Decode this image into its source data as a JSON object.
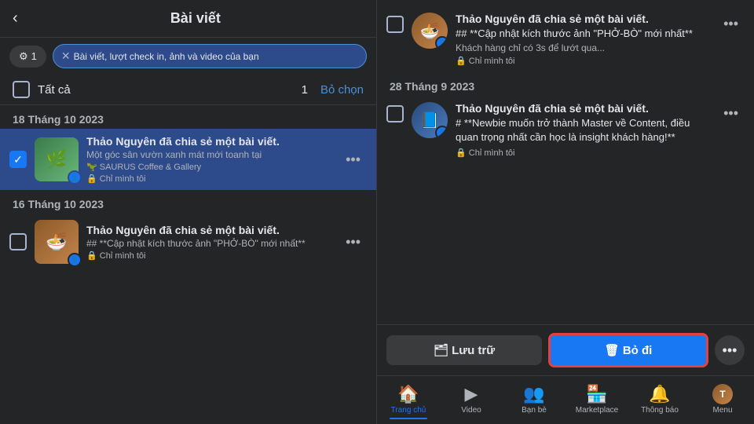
{
  "leftPanel": {
    "header": {
      "back": "‹",
      "title": "Bài viết"
    },
    "filterBtn": {
      "icon": "⚙",
      "number": "1"
    },
    "filterTag": {
      "close": "✕",
      "label": "Bài viết, lượt check in, ảnh và video của bạn"
    },
    "selectBar": {
      "label": "Tất cả",
      "count": "1",
      "deselect": "Bỏ chọn"
    },
    "dateGroups": [
      {
        "date": "18 Tháng 10 2023",
        "posts": [
          {
            "id": "post1",
            "selected": true,
            "thumbType": "garden",
            "thumbEmoji": "🌿",
            "author": "Thảo Nguyên đã chia sẻ một bài viết.",
            "preview": "Một góc sân vườn xanh mát mới toanh tại",
            "location": "🦖 SAURUS Coffee & Gallery",
            "privacy": "🔒 Chỉ mình tôi"
          }
        ]
      },
      {
        "date": "16 Tháng 10 2023",
        "posts": [
          {
            "id": "post2",
            "selected": false,
            "thumbType": "food",
            "thumbEmoji": "🍜",
            "author": "Thảo Nguyên đã chia sẻ một bài viết.",
            "preview": "## **Cập nhật kích thước ảnh \"PHỞ-BÒ\" mới nhất**",
            "privacy": "🔒 Chỉ mình tôi"
          }
        ]
      }
    ]
  },
  "rightPanel": {
    "dateGroups": [
      {
        "date": "",
        "posts": [
          {
            "id": "rpost1",
            "selected": false,
            "avatarBg": "food",
            "avatarEmoji": "🍜",
            "author": "Thảo Nguyên đã chia sẻ một bài viết.",
            "textBold": "## **Cập nhật kích thước ảnh \"PHỞ-BÒ\" mới nhất**",
            "subText": "Khách hàng chỉ có 3s để lướt qua...",
            "privacy": "🔒 Chỉ mình tôi"
          }
        ]
      },
      {
        "date": "28 Tháng 9 2023",
        "posts": [
          {
            "id": "rpost2",
            "selected": false,
            "avatarBg": "training",
            "avatarEmoji": "📘",
            "author": "Thảo Nguyên đã chia sẻ một bài viết.",
            "textBold": "# **Newbie muốn trở thành Master về Content, điều quan trọng nhất cần học là insight khách hàng!**",
            "subText": "",
            "privacy": "🔒 Chỉ mình tôi"
          }
        ]
      }
    ],
    "actionBar": {
      "archiveLabel": "🗂 Lưu trữ",
      "deleteLabel": "🗑 Bỏ đi",
      "moreIcon": "•••"
    },
    "bottomNav": [
      {
        "icon": "🏠",
        "label": "Trang chủ",
        "active": true
      },
      {
        "icon": "▶",
        "label": "Video",
        "active": false
      },
      {
        "icon": "👥",
        "label": "Bạn bè",
        "active": false
      },
      {
        "icon": "🏪",
        "label": "Marketplace",
        "active": false
      },
      {
        "icon": "🔔",
        "label": "Thông báo",
        "active": false
      },
      {
        "icon": "☰",
        "label": "Menu",
        "active": false
      }
    ]
  }
}
